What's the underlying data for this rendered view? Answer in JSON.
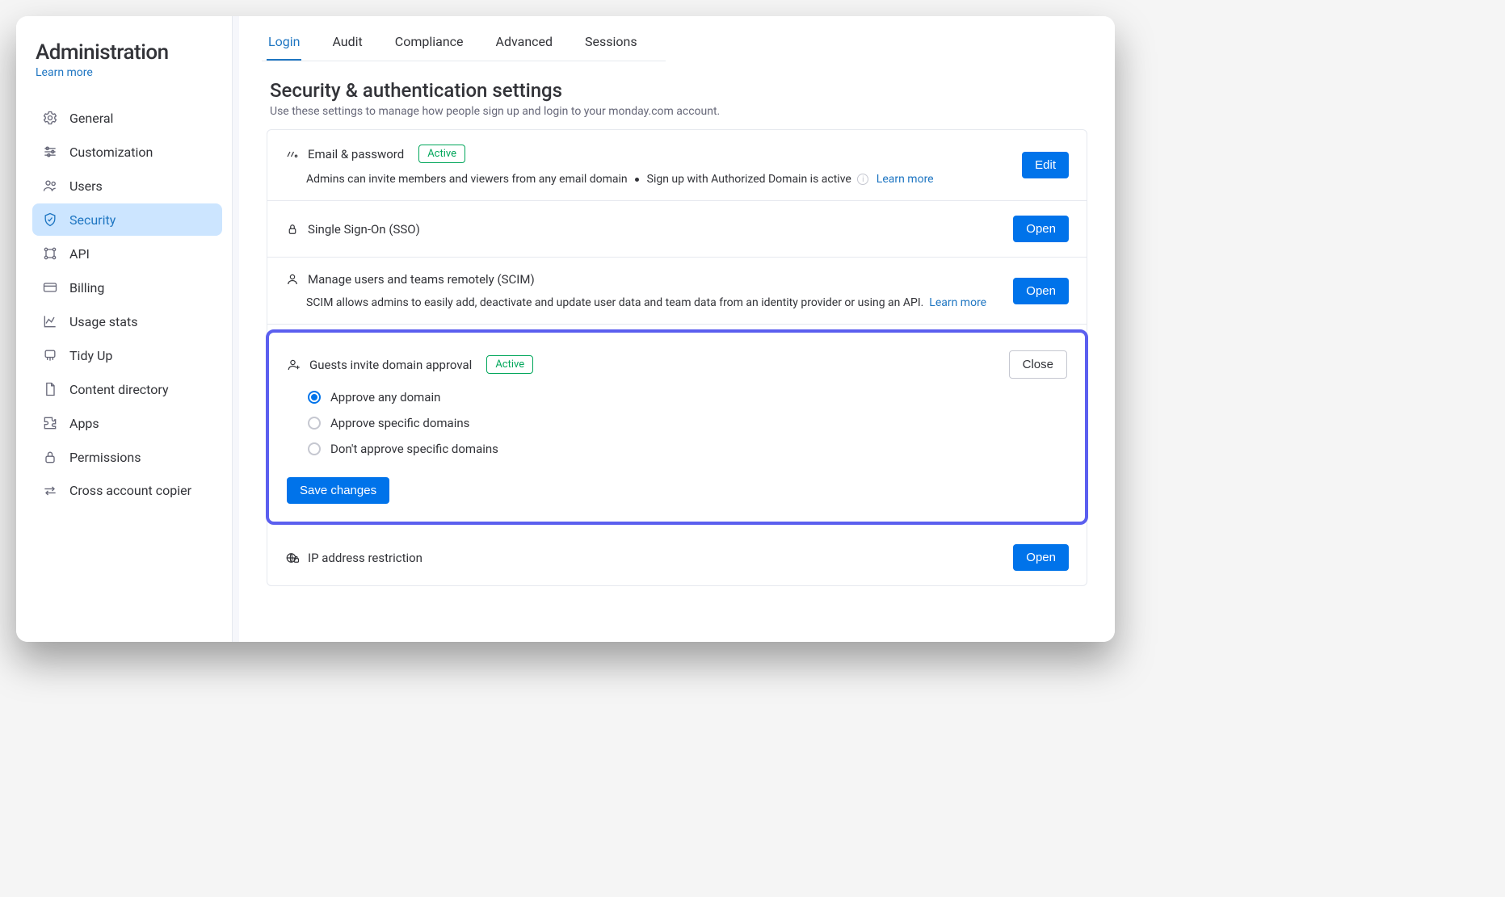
{
  "sidebar": {
    "title": "Administration",
    "learn_more": "Learn more",
    "items": [
      {
        "label": "General"
      },
      {
        "label": "Customization"
      },
      {
        "label": "Users"
      },
      {
        "label": "Security",
        "active": true
      },
      {
        "label": "API"
      },
      {
        "label": "Billing"
      },
      {
        "label": "Usage stats"
      },
      {
        "label": "Tidy Up"
      },
      {
        "label": "Content directory"
      },
      {
        "label": "Apps"
      },
      {
        "label": "Permissions"
      },
      {
        "label": "Cross account copier"
      }
    ]
  },
  "tabs": [
    "Login",
    "Audit",
    "Compliance",
    "Advanced",
    "Sessions"
  ],
  "active_tab": 0,
  "section": {
    "title": "Security & authentication settings",
    "desc": "Use these settings to manage how people sign up and login to your monday.com account."
  },
  "cards": {
    "email_password": {
      "title": "Email & password",
      "badge": "Active",
      "desc_1": "Admins can invite members and viewers from any email domain",
      "desc_2": "Sign up with Authorized Domain is active",
      "learn_more": "Learn more",
      "button": "Edit"
    },
    "sso": {
      "title": "Single Sign-On (SSO)",
      "button": "Open"
    },
    "scim": {
      "title": "Manage users and teams remotely (SCIM)",
      "desc": "SCIM allows admins to easily add, deactivate and update user data and team data from an identity provider or using an API.",
      "learn_more": "Learn more",
      "button": "Open"
    },
    "guests": {
      "title": "Guests invite domain approval",
      "badge": "Active",
      "button": "Close",
      "options": [
        "Approve any domain",
        "Approve specific domains",
        "Don't approve specific domains"
      ],
      "selected": 0,
      "save": "Save changes"
    },
    "ip": {
      "title": "IP address restriction",
      "button": "Open"
    }
  }
}
